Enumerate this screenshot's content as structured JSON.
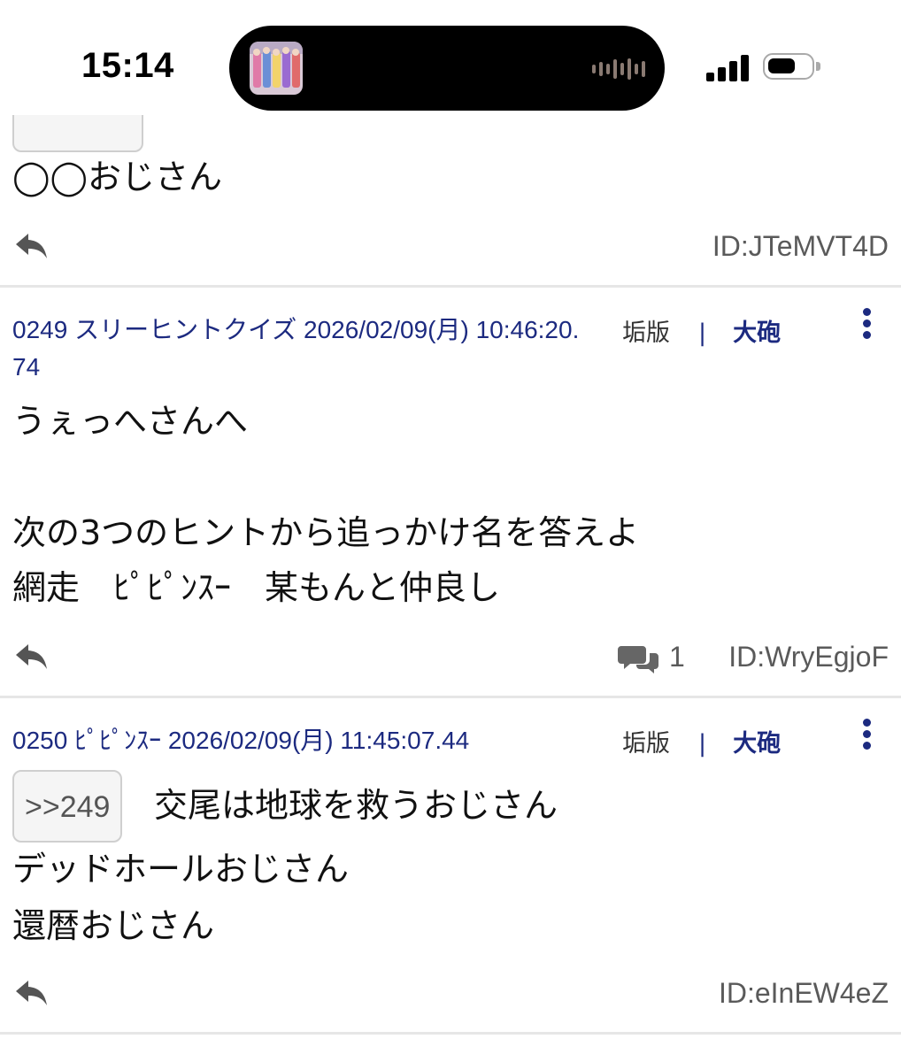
{
  "status_bar": {
    "time": "15:14",
    "now_playing_icon": "album-art-icon",
    "audio_icon": "waveform-icon",
    "signal_icon": "cellular-signal-icon",
    "battery_icon": "battery-icon"
  },
  "posts": [
    {
      "quote": "",
      "lines": [
        "◯◯おじさん"
      ],
      "id": "ID:JTeMVT4D"
    },
    {
      "header": "0249 スリーヒントクイズ 2026/02/09(月) 10:46:20.74",
      "links": {
        "kaiban": "垢版",
        "sep": "|",
        "taiho": "大砲"
      },
      "lines": [
        "うぇっへさんへ",
        "",
        "次の3つのヒントから追っかけ名を答えよ",
        "網走　ﾋﾟﾋﾟﾝｽｰ　某もんと仲良し"
      ],
      "comment_count": "1",
      "id": "ID:WryEgjoF"
    },
    {
      "header": "0250 ﾋﾟﾋﾟﾝｽｰ 2026/02/09(月) 11:45:07.44",
      "links": {
        "kaiban": "垢版",
        "sep": "|",
        "taiho": "大砲"
      },
      "quote": ">>249",
      "lines": [
        "交尾は地球を救うおじさん",
        "デッドホールおじさん",
        "還暦おじさん"
      ],
      "id": "ID:eInEW4eZ"
    }
  ],
  "colors": {
    "header_blue": "#1c2a80",
    "id_gray": "#5a5a5a",
    "divider": "#e6e6e6"
  }
}
